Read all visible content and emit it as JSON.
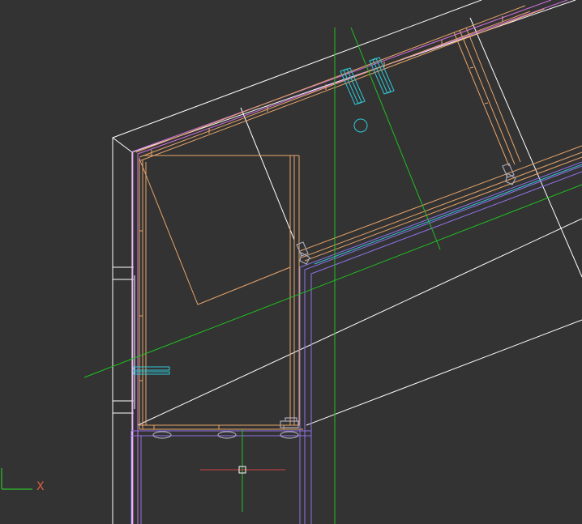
{
  "viewport": {
    "background": "#333333",
    "colors": {
      "wall": "#ffffff",
      "frame": "#e8a56a",
      "magenta": "#d070e0",
      "purple": "#9070e8",
      "green": "#20c020",
      "cyan": "#30c8d8",
      "hardware": "#a8a8b8",
      "cursor": "#d04040"
    }
  },
  "ucs": {
    "x_label": "X",
    "icon": "ucs-axis-icon"
  }
}
